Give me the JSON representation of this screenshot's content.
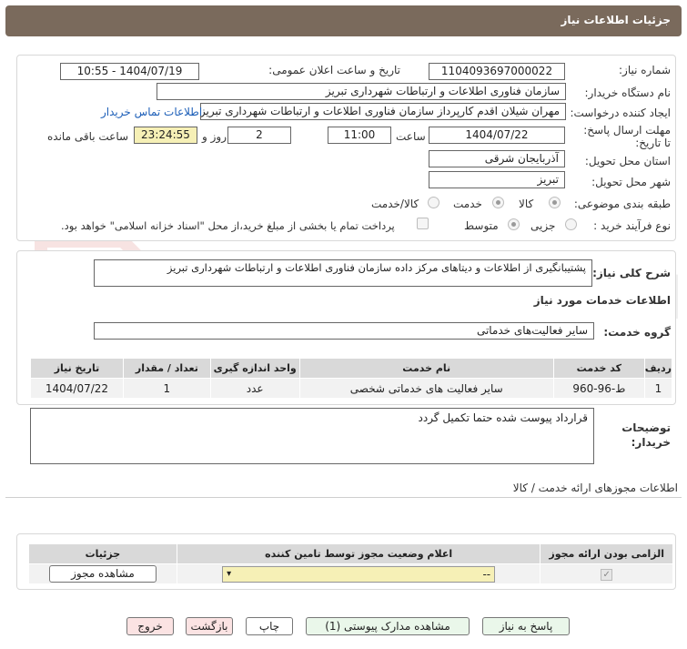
{
  "header": {
    "title": "جزئیات اطلاعات نیاز"
  },
  "form": {
    "need_number_label": "شماره نیاز:",
    "need_number": "1104093697000022",
    "announce_label": "تاریخ و ساعت اعلان عمومی:",
    "announce_value": "1404/07/19 - 10:55",
    "buyer_org_label": "نام دستگاه خریدار:",
    "buyer_org": "سازمان فناوری اطلاعات و ارتباطات شهرداری تبریز",
    "creator_label": "ایجاد کننده درخواست:",
    "creator": "مهران شیلان اقدم کارپرداز سازمان فناوری اطلاعات و ارتباطات شهرداری تبریز",
    "contact_link": "اطلاعات تماس خریدار",
    "deadline_label": "مهلت ارسال پاسخ: تا تاریخ:",
    "deadline_date": "1404/07/22",
    "time_label": "ساعت",
    "deadline_time": "11:00",
    "days_value": "2",
    "days_label": "روز و",
    "remaining_time": "23:24:55",
    "remaining_label": "ساعت باقی مانده",
    "province_label": "استان محل تحویل:",
    "province": "آذربایجان شرقی",
    "city_label": "شهر محل تحویل:",
    "city": "تبریز",
    "category_label": "طبقه بندی موضوعی:",
    "category_options": [
      "کالا",
      "خدمت",
      "کالا/خدمت"
    ],
    "process_label": "نوع فرآیند خرید :",
    "process_options": [
      "جزیی",
      "متوسط"
    ],
    "payment_note": "پرداخت تمام یا بخشی از مبلغ خرید،از محل \"اسناد خزانه اسلامی\" خواهد بود."
  },
  "summary": {
    "label": "شرح کلی نیاز:",
    "text": "پشتیبانگیری از اطلاعات و دیتاهای مرکز داده سازمان فناوری اطلاعات و ارتباطات شهرداری تبریز",
    "services_heading": "اطلاعات خدمات مورد نیاز",
    "group_label": "گروه خدمت:",
    "group_value": "سایر فعالیت‌های خدماتی"
  },
  "services_table": {
    "headers": [
      "ردیف",
      "کد خدمت",
      "نام خدمت",
      "واحد اندازه گیری",
      "تعداد / مقدار",
      "تاریخ نیاز"
    ],
    "rows": [
      [
        "1",
        "ط-96-960",
        "سایر فعالیت های خدماتی شخصی",
        "عدد",
        "1",
        "1404/07/22"
      ]
    ]
  },
  "buyer_notes": {
    "label": "توضیحات خریدار:",
    "text": "قرارداد پیوست شده حتما تکمیل گردد"
  },
  "permits": {
    "section_title": "اطلاعات مجوزهای ارائه خدمت / کالا",
    "headers": [
      "الزامی بودن ارائه مجوز",
      "اعلام وضعیت مجوز توسط تامین کننده",
      "جزئیات"
    ],
    "select_value": "--",
    "view_button": "مشاهده مجوز"
  },
  "footer_buttons": {
    "reply": "پاسخ به نیاز",
    "docs": "مشاهده مدارک پیوستی (1)",
    "print": "چاپ",
    "back": "بازگشت",
    "exit": "خروج"
  },
  "watermark": {
    "text": "AriaTender.net"
  }
}
